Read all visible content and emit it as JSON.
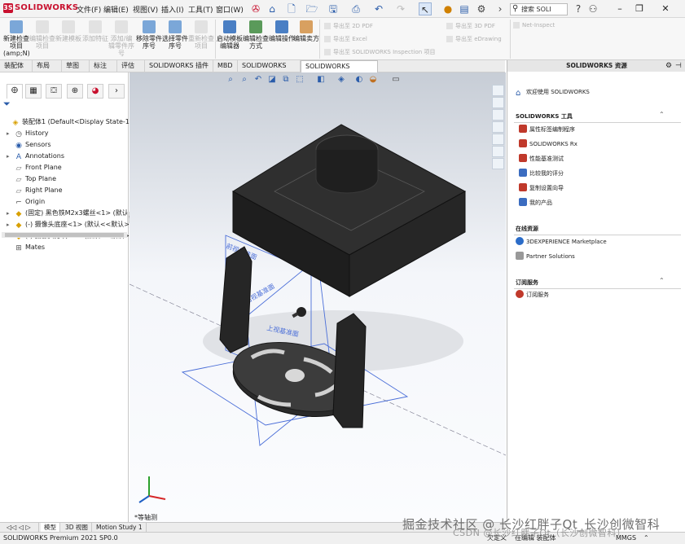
{
  "app": {
    "logo": "SOLIDWORKS"
  },
  "menu": [
    "文件(F)",
    "编辑(E)",
    "视图(V)",
    "插入(I)",
    "工具(T)",
    "窗口(W)"
  ],
  "search": {
    "placeholder": "搜索 SOLI"
  },
  "ribbon": {
    "buttons": [
      {
        "label": "新建检查项目(amp;N)",
        "enabled": true
      },
      {
        "label": "编辑检查项目",
        "enabled": false
      },
      {
        "label": "新建模板",
        "enabled": false
      },
      {
        "label": "添加特征",
        "enabled": false
      },
      {
        "label": "添加/编辑零件序号",
        "enabled": false
      },
      {
        "label": "移除零件序号",
        "enabled": true
      },
      {
        "label": "选择零件序号",
        "enabled": true
      },
      {
        "label": "重新检查项目",
        "enabled": false
      },
      {
        "label": "启动模板编辑器",
        "enabled": true
      },
      {
        "label": "编辑检查方式",
        "enabled": true
      },
      {
        "label": "编辑操作",
        "enabled": true
      },
      {
        "label": "编辑卖方",
        "enabled": true
      }
    ],
    "export_items": [
      "导出至 2D PDF",
      "导出至 Excel",
      "导出至 SOLIDWORKS Inspection 项目"
    ],
    "export_items2": [
      "导出至 3D PDF",
      "导出至 eDrawing"
    ],
    "net_inspect": "Net-Inspect"
  },
  "tabs": [
    "装配体",
    "布局",
    "草图",
    "标注",
    "评估",
    "SOLIDWORKS 插件",
    "MBD",
    "SOLIDWORKS CAM",
    "SOLIDWORKS Inspection"
  ],
  "active_tab": "SOLIDWORKS Inspection",
  "tree": [
    {
      "label": "装配体1  (Default<Display State-1>)",
      "icon": "assembly-icon",
      "level": 0,
      "expand": false
    },
    {
      "label": "History",
      "icon": "history-icon",
      "level": 1,
      "expand": true
    },
    {
      "label": "Sensors",
      "icon": "sensor-icon",
      "level": 1,
      "expand": false
    },
    {
      "label": "Annotations",
      "icon": "annotation-icon",
      "level": 1,
      "expand": true
    },
    {
      "label": "Front Plane",
      "icon": "plane-icon",
      "level": 1,
      "expand": false
    },
    {
      "label": "Top Plane",
      "icon": "plane-icon",
      "level": 1,
      "expand": false
    },
    {
      "label": "Right Plane",
      "icon": "plane-icon",
      "level": 1,
      "expand": false
    },
    {
      "label": "Origin",
      "icon": "origin-icon",
      "level": 1,
      "expand": false
    },
    {
      "label": "(固定) 黑色铁M2x3螺丝<1> (默认<...",
      "icon": "part-icon",
      "level": 1,
      "expand": true
    },
    {
      "label": "(-) 摄像头底座<1> (默认<<默认>_...",
      "icon": "part-icon",
      "level": 1,
      "expand": true
    },
    {
      "label": "(-) 摄像头方块<1> (默认<<默认>_...",
      "icon": "part-icon",
      "level": 1,
      "expand": true
    },
    {
      "label": "Mates",
      "icon": "mates-icon",
      "level": 1,
      "expand": false
    }
  ],
  "viewport": {
    "plane_labels": [
      "前视基准面",
      "右视基准面",
      "上视基准面"
    ],
    "view_name": "*等轴测"
  },
  "right_panel": {
    "title": "SOLIDWORKS 资源",
    "welcome": "欢迎使用 SOLIDWORKS",
    "sections": [
      {
        "title": "SOLIDWORKS 工具",
        "items": [
          "属性标签编制程序",
          "SOLIDWORKS Rx",
          "性能基准测试",
          "比较我的评分",
          "复制设置向导",
          "我的产品"
        ]
      },
      {
        "title": "在线资源",
        "items": [
          "3DEXPERIENCE Marketplace",
          "Partner Solutions"
        ]
      },
      {
        "title": "订阅服务",
        "items": [
          "订阅服务"
        ]
      }
    ]
  },
  "bottom_tabs": [
    "模型",
    "3D 视图",
    "Motion Study 1"
  ],
  "status": {
    "left": "SOLIDWORKS Premium 2021 SP0.0",
    "state1": "欠定义",
    "state2": "在编辑 装配体",
    "units": "MMGS"
  },
  "watermark": {
    "line1": "掘金技术社区 @ 长沙红胖子Qt_长沙创微智科",
    "line2": "CSDN @长沙红胖子Qt（长沙创微智科）"
  }
}
